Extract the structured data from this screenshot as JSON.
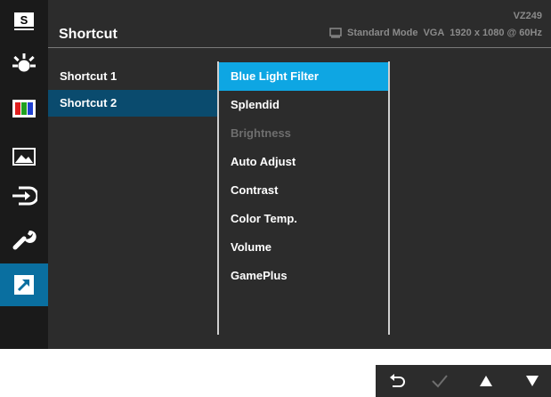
{
  "header": {
    "title": "Shortcut",
    "model": "VZ249",
    "mode": "Standard Mode",
    "input": "VGA",
    "resolution": "1920 x 1080 @ 60Hz"
  },
  "rail": {
    "items": [
      {
        "icon": "splendid-s-icon"
      },
      {
        "icon": "blue-light-icon"
      },
      {
        "icon": "color-bars-icon"
      },
      {
        "icon": "image-icon"
      },
      {
        "icon": "input-select-icon"
      },
      {
        "icon": "system-setup-wrench-icon"
      },
      {
        "icon": "shortcut-arrow-icon",
        "active": true
      }
    ]
  },
  "shortcuts": [
    {
      "label": "Shortcut 1"
    },
    {
      "label": "Shortcut 2",
      "selected": true
    }
  ],
  "options": [
    {
      "label": "Blue Light Filter",
      "selected": true
    },
    {
      "label": "Splendid"
    },
    {
      "label": "Brightness",
      "disabled": true
    },
    {
      "label": "Auto Adjust"
    },
    {
      "label": "Contrast"
    },
    {
      "label": "Color Temp."
    },
    {
      "label": "Volume"
    },
    {
      "label": "GamePlus"
    }
  ],
  "keys": [
    {
      "icon": "back-icon"
    },
    {
      "icon": "check-icon"
    },
    {
      "icon": "up-arrow-icon"
    },
    {
      "icon": "down-arrow-icon"
    }
  ],
  "colors": {
    "accent_selected": "#0ea6e3",
    "accent_active": "#0a6fa0",
    "row_selected": "#0a4b6e",
    "panel": "#2c2c2c",
    "rail": "#1a1a1a"
  }
}
